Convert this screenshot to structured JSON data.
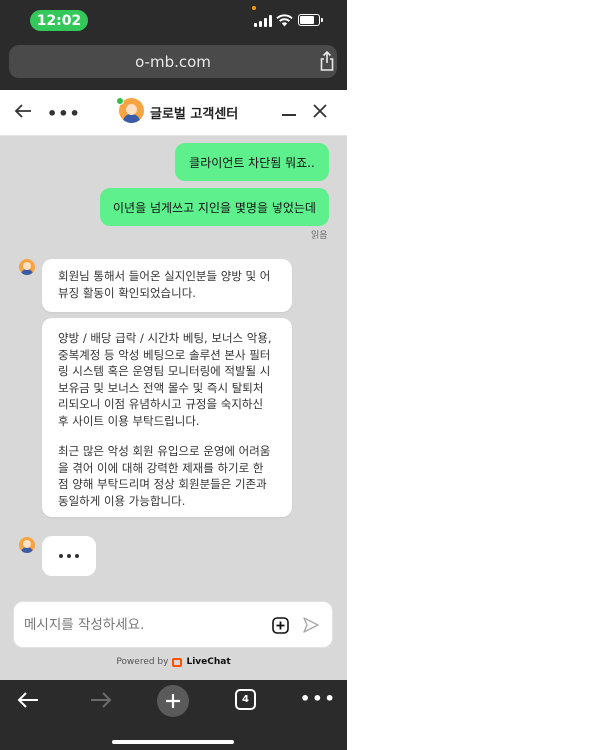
{
  "status_bar": {
    "time": "12:02"
  },
  "browser": {
    "url": "o-mb.com",
    "tab_count": "4"
  },
  "chat_header": {
    "title": "글로벌 고객센터",
    "more": "•••"
  },
  "messages_out": [
    {
      "text": "클라이언트 차단됨 뭐죠.."
    },
    {
      "text": "이년을 넘게쓰고 지인을 몇명을 넣었는데"
    }
  ],
  "read_status": "읽음",
  "messages_in": [
    {
      "lines": [
        "회원님 통해서 들어온 실지인분들 양방 및 어",
        "뷰징 활동이 확인되었습니다."
      ]
    },
    {
      "paragraph1": [
        "양방 / 배당 급락 / 시간차 베팅, 보너스 악용,",
        "중복계정 등 악성 베팅으로 솔루션 본사 필터",
        "링 시스템 혹은 운영팀 모니터링에 적발될 시",
        "보유금 및 보너스 전액 몰수 및 즉시 탈퇴처",
        "리되오니 이점 유념하시고 규정을 숙지하신",
        "후 사이트 이용 부탁드립니다."
      ],
      "paragraph2": [
        "최근 많은 악성 회원 유입으로 운영에 어려움",
        "을 겪어 이에 대해 강력한 제재를 하기로 한",
        "점 양해 부탁드리며 정상 회원분들은 기존과",
        "동일하게 이용 가능합니다."
      ]
    }
  ],
  "composer": {
    "placeholder": "메시지를 작성하세요."
  },
  "powered_by": {
    "prefix": "Powered by",
    "brand": "LiveChat"
  },
  "colors": {
    "outgoing_bubble": "#5ff08e",
    "time_pill": "#34c759",
    "chrome_bg": "#2b2b2b",
    "brand_accent": "#ff5100"
  },
  "icons": [
    "share-icon",
    "back-arrow-icon",
    "more-icon",
    "agent-avatar",
    "minimize-icon",
    "close-icon",
    "attach-plus-icon",
    "send-icon",
    "livechat-icon",
    "forward-arrow-icon",
    "new-tab-plus-icon",
    "tabs-icon"
  ]
}
